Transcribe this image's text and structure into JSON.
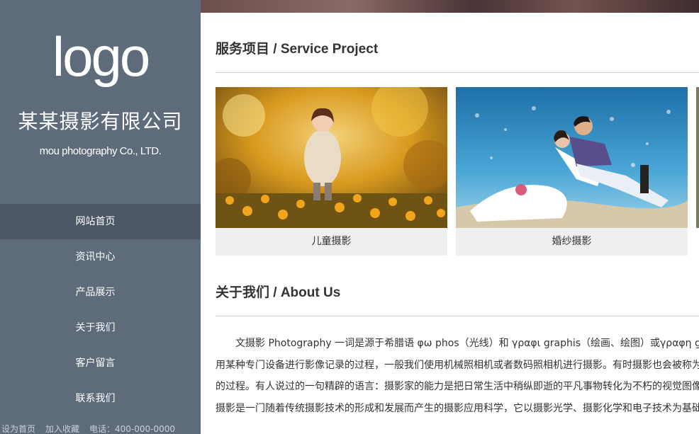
{
  "sidebar": {
    "logo": "logo",
    "company_cn": "某某摄影有限公司",
    "company_en": "mou photography  Co., LTD.",
    "nav": [
      {
        "label": "网站首页",
        "active": true
      },
      {
        "label": "资讯中心",
        "active": false
      },
      {
        "label": "产品展示",
        "active": false
      },
      {
        "label": "关于我们",
        "active": false
      },
      {
        "label": "客户留言",
        "active": false
      },
      {
        "label": "联系我们",
        "active": false
      }
    ],
    "footer": {
      "set_home": "设为首页",
      "add_favorite": "加入收藏",
      "phone": "电话：400-000-0000"
    }
  },
  "services": {
    "title": "服务项目 / Service Project",
    "items": [
      {
        "caption": "儿童摄影"
      },
      {
        "caption": "婚纱摄影"
      }
    ]
  },
  "about": {
    "title": "关于我们 / About Us",
    "lines": [
      "文摄影 Photography 一词是源于希腊语 φω phos（光线）和 γραφι graphis（绘画、绘图）或γραφη g",
      "用某种专门设备进行影像记录的过程，一般我们使用机械照相机或者数码照相机进行摄影。有时摄影也会被称为",
      "的过程。有人说过的一句精辟的语言：摄影家的能力是把日常生活中稍纵即逝的平凡事物转化为不朽的视觉图像",
      "摄影是一门随着传统摄影技术的形成和发展而产生的摄影应用科学，它以摄影光学、摄影化学和电子技术为基础"
    ]
  },
  "colors": {
    "sidebar_bg": "#5e6b7b",
    "nav_active_bg": "#4c5765",
    "card_bg": "#efefef",
    "rule": "#cfcfcf"
  }
}
